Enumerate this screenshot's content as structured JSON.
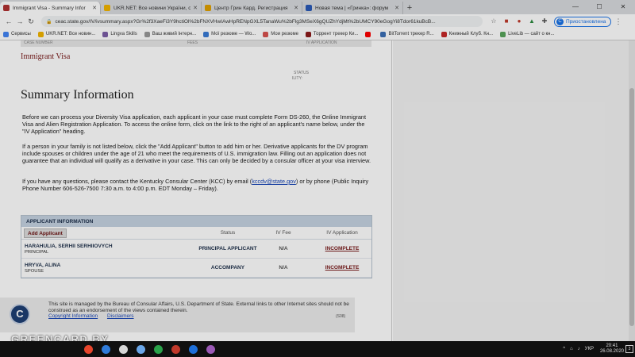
{
  "browser": {
    "tabs": [
      {
        "label": "Immigrant Visa - Summary Infor",
        "color": "#b03030",
        "active": true
      },
      {
        "label": "UKR.NET: Все новини України, о",
        "color": "#f2b400",
        "active": false
      },
      {
        "label": "Центр Грин Кард. Регистрация",
        "color": "#e0a000",
        "active": false
      },
      {
        "label": "Новая тема | «Гринка»: форум",
        "color": "#2b5bb8",
        "active": false
      }
    ],
    "new_tab": "+",
    "window_controls": {
      "minimize": "—",
      "maximize": "☐",
      "close": "✕"
    },
    "url": "ceac.state.gov/IV/ivsummary.aspx?Gr%2f3XaeFi3Y9hctiOl%2bFNXVHwIAwHpRENpGXL5TanaWu%2bFlg3MSeX6gQUZhYdjMt%2bUMCY90eGogYi8Tdor61kuBcB...",
    "paused_label": "Приостановлена",
    "paused_avatar": "C",
    "bookmarks": [
      {
        "label": "Сервисы",
        "color": "#4285f4"
      },
      {
        "label": "UKR.NET: Все новин...",
        "color": "#f2b400"
      },
      {
        "label": "Lingva Skills",
        "color": "#7b5ea7"
      },
      {
        "label": "Ваш живий Інтерн...",
        "color": "#999999"
      },
      {
        "label": "Мої резюме — Wo...",
        "color": "#3a7bd5"
      },
      {
        "label": "Мои резюме",
        "color": "#d9534f"
      },
      {
        "label": "Торрент трекер Ки...",
        "color": "#8b1a1a"
      },
      {
        "label": "",
        "color": "#ff0000"
      },
      {
        "label": "BitTorrent трекер R...",
        "color": "#3b6fb6"
      },
      {
        "label": "Книжный Клуб. Кн...",
        "color": "#c62828"
      },
      {
        "label": "LiveLib — сайт о кн...",
        "color": "#58a55c"
      }
    ]
  },
  "page": {
    "top_strip": [
      "CASE NUMBER",
      "FEES",
      "IV APPLICATION"
    ],
    "visa_type": "Immigrant Visa",
    "ghost_text_1": "STATUS",
    "ghost_text_2": "ILITY:",
    "title": "Summary Information",
    "para1": "Before we can process your Diversity Visa application, each applicant in your case must complete Form DS-260, the Online Immigrant Visa and Alien Registration Application. To access the online form, click on the link to the right of an applicant's name below, under the \"IV Application\" heading.",
    "para2": "If a person in your family is not listed below, click the \"Add Applicant\" button to add him or her. Derivative applicants for the DV program include spouses or children under the age of 21 who meet the requirements of U.S. immigration law. Filling out an application does not guarantee that an individual will qualify as a derivative in your case. This can only be decided by a consular officer at your visa interview.",
    "para3_a": "If you have any questions, please contact the Kentucky Consular Center (KCC) by email (",
    "para3_email": "kccdv@state.gov",
    "para3_b": ") or by phone (Public Inquiry Phone Number 606-526-7500 7:30 a.m. to 4:00 p.m. EDT Monday – Friday).",
    "applicants": {
      "header": "APPLICANT INFORMATION",
      "add_button": "Add Applicant",
      "col_status": "Status",
      "col_fee": "IV Fee",
      "col_ivapp": "IV Application",
      "rows": [
        {
          "name": "HARAHULIA, SERHII SERHIIOVYCH",
          "role": "PRINCIPAL",
          "status": "PRINCIPAL APPLICANT",
          "fee": "N/A",
          "ivapp": "INCOMPLETE"
        },
        {
          "name": "HRYVA, ALINA",
          "role": "SPOUSE",
          "status": "ACCOMPANY",
          "fee": "N/A",
          "ivapp": "INCOMPLETE"
        }
      ]
    },
    "footer": {
      "seal": "C",
      "text": "This site is managed by the Bureau of Consular Affairs, U.S. Department of State. External links to other Internet sites should not be construed as an endorsement of the views contained therein.",
      "links": [
        "Copyright Information",
        "Disclaimers"
      ],
      "code": "(S08)"
    }
  },
  "watermark": "GREENCARD.BY",
  "taskbar": {
    "apps": [
      "#e8452c",
      "#2f7bd9",
      "#d6d6d6",
      "#6aa6e8",
      "#2aa24a",
      "#c0392b",
      "#1e6fd9",
      "#9b59b6"
    ],
    "tray": {
      "chevron": "^",
      "network": "⌂",
      "sound": "♪",
      "lang": "УКР",
      "time": "20:41",
      "date": "26.08.2020",
      "notifications": "3"
    }
  }
}
